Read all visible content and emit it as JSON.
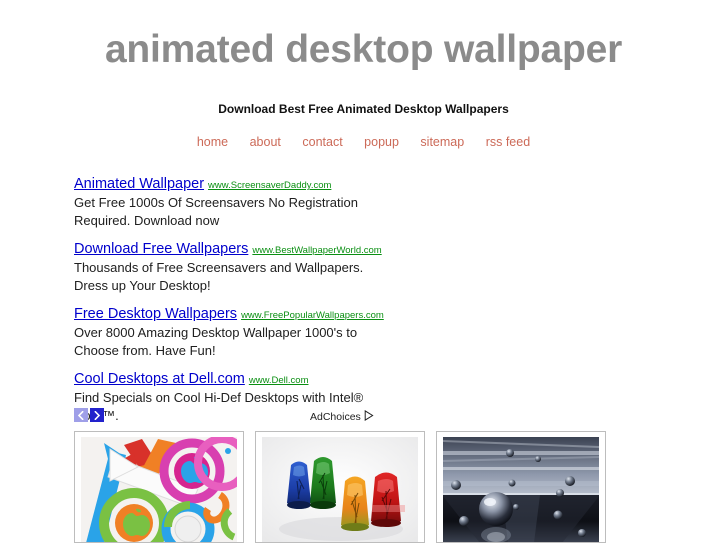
{
  "header": {
    "title": "animated desktop wallpaper",
    "subtitle": "Download Best Free Animated Desktop Wallpapers",
    "title_color": "#8b8b8b"
  },
  "nav": {
    "link_color": "#cc6a58",
    "items": [
      {
        "label": "home",
        "name": "nav-item-home"
      },
      {
        "label": "about",
        "name": "nav-item-about"
      },
      {
        "label": "contact",
        "name": "nav-item-contact"
      },
      {
        "label": "popup",
        "name": "nav-item-popup"
      },
      {
        "label": "sitemap",
        "name": "nav-item-sitemap"
      },
      {
        "label": "rss feed",
        "name": "nav-item-rss-feed"
      }
    ]
  },
  "ads": {
    "title_color": "#0000cc",
    "url_color": "#0a8f12",
    "items": [
      {
        "title": "Animated Wallpaper",
        "url": "www.ScreensaverDaddy.com",
        "description": "Get Free 1000s Of Screensavers No Registration Required. Download now"
      },
      {
        "title": "Download Free Wallpapers",
        "url": "www.BestWallpaperWorld.com",
        "description": "Thousands of Free Screensavers and Wallpapers. Dress up Your Desktop!"
      },
      {
        "title": "Free Desktop Wallpapers",
        "url": "www.FreePopularWallpapers.com",
        "description": "Over 8000 Amazing Desktop Wallpaper 1000's to Choose from. Have Fun!"
      },
      {
        "title": "Cool Desktops at Dell.com",
        "url": "www.Dell.com",
        "description": "Find Specials on Cool Hi-Def Desktops with Intel® Core™."
      }
    ],
    "pager": {
      "prev_icon": "chevron-left-icon",
      "next_icon": "chevron-right-icon",
      "prev_color": "#9f9fe8",
      "next_color": "#2222cc"
    },
    "adchoices": {
      "label": "AdChoices",
      "icon": "adchoices-triangle-icon"
    }
  },
  "thumbnails": [
    {
      "name": "thumbnail-colorful-arrows-apple",
      "alt": "colorful arrows and rings with apple logos"
    },
    {
      "name": "thumbnail-colored-glass-cups",
      "alt": "four colored glass cups with trees"
    },
    {
      "name": "thumbnail-chrome-spheres",
      "alt": "chrome spheres in reflective room"
    }
  ]
}
